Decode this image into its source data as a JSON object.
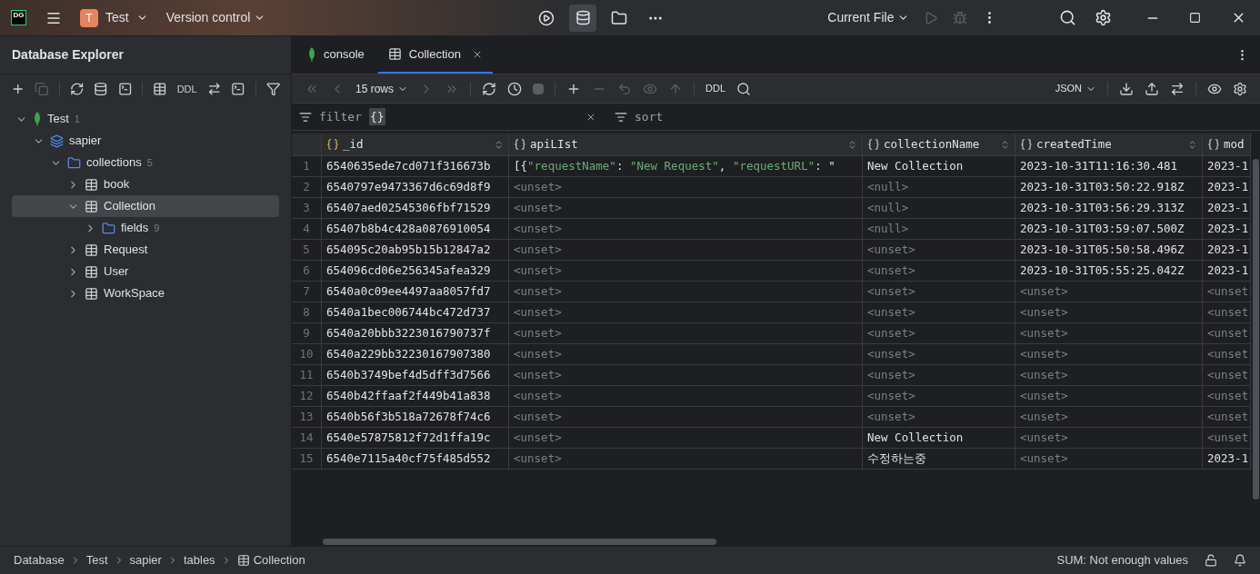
{
  "titlebar": {
    "app_logo": "DG",
    "project_initial": "T",
    "project": "Test",
    "vcs": "Version control",
    "run_config": "Current File"
  },
  "sidebar": {
    "title": "Database Explorer",
    "toolbar_ddl": "DDL",
    "tree": [
      {
        "label": "Test",
        "kind": "mongo",
        "count": "1",
        "expanded": true,
        "selected": false,
        "children": [
          {
            "label": "sapier",
            "kind": "schema",
            "expanded": true,
            "selected": false,
            "children": [
              {
                "label": "collections",
                "kind": "folder",
                "count": "5",
                "expanded": true,
                "selected": false,
                "children": [
                  {
                    "label": "book",
                    "kind": "table",
                    "expanded": false,
                    "selected": false
                  },
                  {
                    "label": "Collection",
                    "kind": "table",
                    "expanded": true,
                    "selected": true,
                    "children": [
                      {
                        "label": "fields",
                        "kind": "folder",
                        "count": "9",
                        "expanded": false,
                        "selected": false
                      }
                    ]
                  },
                  {
                    "label": "Request",
                    "kind": "table",
                    "expanded": false,
                    "selected": false
                  },
                  {
                    "label": "User",
                    "kind": "table",
                    "expanded": false,
                    "selected": false
                  },
                  {
                    "label": "WorkSpace",
                    "kind": "table",
                    "expanded": false,
                    "selected": false
                  }
                ]
              }
            ]
          }
        ]
      }
    ]
  },
  "tabs": [
    {
      "label": "console",
      "kind": "mongo",
      "selected": false,
      "closable": false
    },
    {
      "label": "Collection",
      "kind": "table",
      "selected": true,
      "closable": true
    }
  ],
  "toolbar": {
    "rows": "15 rows",
    "ddl": "DDL",
    "format": "JSON"
  },
  "filter": {
    "label": "filter",
    "value": "{}",
    "sort": "sort"
  },
  "table": {
    "columns": [
      {
        "name": "_id",
        "primary_key": true,
        "sortable": true
      },
      {
        "name": "apiLIst",
        "primary_key": false,
        "sortable": true
      },
      {
        "name": "collectionName",
        "primary_key": false,
        "sortable": true
      },
      {
        "name": "createdTime",
        "primary_key": false,
        "sortable": true
      },
      {
        "name": "mod",
        "primary_key": false,
        "sortable": false
      }
    ],
    "rows": [
      {
        "num": "1",
        "cells": [
          {
            "kind": "value",
            "text": "6540635ede7cd071f316673b"
          },
          {
            "kind": "json",
            "tokens": [
              {
                "kind": "punct",
                "text": "[{"
              },
              {
                "kind": "string",
                "text": "\"requestName\""
              },
              {
                "kind": "punct",
                "text": ": "
              },
              {
                "kind": "string",
                "text": "\"New Request\""
              },
              {
                "kind": "punct",
                "text": ", "
              },
              {
                "kind": "string",
                "text": "\"requestURL\""
              },
              {
                "kind": "punct",
                "text": ": \""
              }
            ]
          },
          {
            "kind": "value",
            "text": "New Collection"
          },
          {
            "kind": "value",
            "text": "2023-10-31T11:16:30.481"
          },
          {
            "kind": "value",
            "text": "2023-1"
          }
        ]
      },
      {
        "num": "2",
        "cells": [
          {
            "kind": "value",
            "text": "6540797e9473367d6c69d8f9"
          },
          {
            "kind": "unset",
            "text": "<unset>"
          },
          {
            "kind": "unset",
            "text": "<null>"
          },
          {
            "kind": "value",
            "text": "2023-10-31T03:50:22.918Z"
          },
          {
            "kind": "value",
            "text": "2023-1"
          }
        ]
      },
      {
        "num": "3",
        "cells": [
          {
            "kind": "value",
            "text": "65407aed02545306fbf71529"
          },
          {
            "kind": "unset",
            "text": "<unset>"
          },
          {
            "kind": "unset",
            "text": "<null>"
          },
          {
            "kind": "value",
            "text": "2023-10-31T03:56:29.313Z"
          },
          {
            "kind": "value",
            "text": "2023-1"
          }
        ]
      },
      {
        "num": "4",
        "cells": [
          {
            "kind": "value",
            "text": "65407b8b4c428a0876910054"
          },
          {
            "kind": "unset",
            "text": "<unset>"
          },
          {
            "kind": "unset",
            "text": "<null>"
          },
          {
            "kind": "value",
            "text": "2023-10-31T03:59:07.500Z"
          },
          {
            "kind": "value",
            "text": "2023-1"
          }
        ]
      },
      {
        "num": "5",
        "cells": [
          {
            "kind": "value",
            "text": "654095c20ab95b15b12847a2"
          },
          {
            "kind": "unset",
            "text": "<unset>"
          },
          {
            "kind": "unset",
            "text": "<unset>"
          },
          {
            "kind": "value",
            "text": "2023-10-31T05:50:58.496Z"
          },
          {
            "kind": "value",
            "text": "2023-1"
          }
        ]
      },
      {
        "num": "6",
        "cells": [
          {
            "kind": "value",
            "text": "654096cd06e256345afea329"
          },
          {
            "kind": "unset",
            "text": "<unset>"
          },
          {
            "kind": "unset",
            "text": "<unset>"
          },
          {
            "kind": "value",
            "text": "2023-10-31T05:55:25.042Z"
          },
          {
            "kind": "value",
            "text": "2023-1"
          }
        ]
      },
      {
        "num": "7",
        "cells": [
          {
            "kind": "value",
            "text": "6540a0c09ee4497aa8057fd7"
          },
          {
            "kind": "unset",
            "text": "<unset>"
          },
          {
            "kind": "unset",
            "text": "<unset>"
          },
          {
            "kind": "unset",
            "text": "<unset>"
          },
          {
            "kind": "unset",
            "text": "<unset"
          }
        ]
      },
      {
        "num": "8",
        "cells": [
          {
            "kind": "value",
            "text": "6540a1bec006744bc472d737"
          },
          {
            "kind": "unset",
            "text": "<unset>"
          },
          {
            "kind": "unset",
            "text": "<unset>"
          },
          {
            "kind": "unset",
            "text": "<unset>"
          },
          {
            "kind": "unset",
            "text": "<unset"
          }
        ]
      },
      {
        "num": "9",
        "cells": [
          {
            "kind": "value",
            "text": "6540a20bbb3223016790737f"
          },
          {
            "kind": "unset",
            "text": "<unset>"
          },
          {
            "kind": "unset",
            "text": "<unset>"
          },
          {
            "kind": "unset",
            "text": "<unset>"
          },
          {
            "kind": "unset",
            "text": "<unset"
          }
        ]
      },
      {
        "num": "10",
        "cells": [
          {
            "kind": "value",
            "text": "6540a229bb32230167907380"
          },
          {
            "kind": "unset",
            "text": "<unset>"
          },
          {
            "kind": "unset",
            "text": "<unset>"
          },
          {
            "kind": "unset",
            "text": "<unset>"
          },
          {
            "kind": "unset",
            "text": "<unset"
          }
        ]
      },
      {
        "num": "11",
        "cells": [
          {
            "kind": "value",
            "text": "6540b3749bef4d5dff3d7566"
          },
          {
            "kind": "unset",
            "text": "<unset>"
          },
          {
            "kind": "unset",
            "text": "<unset>"
          },
          {
            "kind": "unset",
            "text": "<unset>"
          },
          {
            "kind": "unset",
            "text": "<unset"
          }
        ]
      },
      {
        "num": "12",
        "cells": [
          {
            "kind": "value",
            "text": "6540b42ffaaf2f449b41a838"
          },
          {
            "kind": "unset",
            "text": "<unset>"
          },
          {
            "kind": "unset",
            "text": "<unset>"
          },
          {
            "kind": "unset",
            "text": "<unset>"
          },
          {
            "kind": "unset",
            "text": "<unset"
          }
        ]
      },
      {
        "num": "13",
        "cells": [
          {
            "kind": "value",
            "text": "6540b56f3b518a72678f74c6"
          },
          {
            "kind": "unset",
            "text": "<unset>"
          },
          {
            "kind": "unset",
            "text": "<unset>"
          },
          {
            "kind": "unset",
            "text": "<unset>"
          },
          {
            "kind": "unset",
            "text": "<unset"
          }
        ]
      },
      {
        "num": "14",
        "cells": [
          {
            "kind": "value",
            "text": "6540e57875812f72d1ffa19c"
          },
          {
            "kind": "unset",
            "text": "<unset>"
          },
          {
            "kind": "value",
            "text": "New Collection"
          },
          {
            "kind": "unset",
            "text": "<unset>"
          },
          {
            "kind": "unset",
            "text": "<unset"
          }
        ]
      },
      {
        "num": "15",
        "cells": [
          {
            "kind": "value",
            "text": "6540e7115a40cf75f485d552"
          },
          {
            "kind": "unset",
            "text": "<unset>"
          },
          {
            "kind": "value",
            "text": "수정하는중"
          },
          {
            "kind": "unset",
            "text": "<unset>"
          },
          {
            "kind": "value",
            "text": "2023-1"
          }
        ]
      }
    ]
  },
  "status_bar": {
    "breadcrumbs": [
      {
        "label": "Database",
        "kind": "text"
      },
      {
        "label": "Test",
        "kind": "text"
      },
      {
        "label": "sapier",
        "kind": "text"
      },
      {
        "label": "tables",
        "kind": "text"
      },
      {
        "label": "Collection",
        "kind": "table"
      }
    ],
    "sum": "SUM: Not enough values"
  }
}
